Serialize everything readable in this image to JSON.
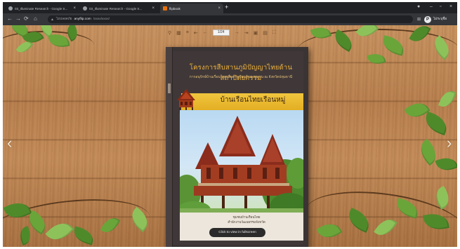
{
  "browser": {
    "tabs": [
      {
        "title": "03_Illuminate Research - Google S...",
        "active": false,
        "icon": "file-icon"
      },
      {
        "title": "03_Illuminate Research - Google S...",
        "active": false,
        "icon": "file-icon"
      },
      {
        "title": "flipbook",
        "active": true,
        "icon": "doc-icon"
      }
    ],
    "new_tab_label": "+",
    "address": {
      "secure_label": "ไม่ปลอดภัย",
      "host": "anyflip.com",
      "path": "/xxxx/xxxx/"
    },
    "profile": {
      "initial": "P",
      "name": "ไม่ระบุชื่อ"
    }
  },
  "viewer": {
    "page_indicator": "1/24",
    "toolbar_icons": [
      "zoom-icon",
      "thumbnails-icon",
      "share-icon",
      "sound-icon",
      "first-page-icon",
      "prev-page-icon",
      "next-page-icon",
      "last-page-icon",
      "print-icon",
      "fullscreen-icon"
    ]
  },
  "book": {
    "title": "โครงการสืบสานภูมิปัญญาไทยด้านสถาปัตยกรรม",
    "subtitle": "การอนุรักษ์บ้านเรือนไทยเพื่อการเรียนรู้ของชุมชน ณ จังหวัดปทุมธานี",
    "banner": "บ้านเรือนไทยเรือนหมู่",
    "caption_line1": "ชุมชนบ้านเรือนไทย",
    "caption_line2": "สำนักงานวัฒนธรรมจังหวัด"
  },
  "status_pill": "Click to view in fullscreen",
  "colors": {
    "accent_title": "#f0b23b",
    "banner": "#e3ae22",
    "book_bg": "#3b3434"
  }
}
